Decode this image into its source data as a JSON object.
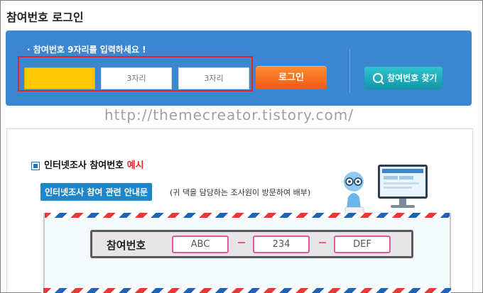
{
  "page": {
    "title": "참여번호 로그인"
  },
  "login": {
    "instruction": "· 참여번호 9자리를 입력하세요 !",
    "fields": [
      {
        "value": "",
        "placeholder": ""
      },
      {
        "value": "",
        "placeholder": "3자리"
      },
      {
        "value": "",
        "placeholder": "3자리"
      }
    ],
    "login_label": "로그인",
    "find_label": "참여번호 찾기"
  },
  "watermark": "http://themecreator.tistory.com/",
  "example": {
    "title": "인터넷조사 참여번호",
    "title_highlight": "예시",
    "guide_button": "인터넷조사 참여 관련 안내문",
    "guide_note": "(귀 댁을 담당하는 조사원이 방문하여 배부)",
    "card_label": "참여번호",
    "parts": [
      "ABC",
      "234",
      "DEF"
    ],
    "separator": "–"
  },
  "colors": {
    "panel": "#3a86d0",
    "highlight_field": "#ffc805",
    "login_button": "#f15a12",
    "find_button": "#1396a7",
    "highlight_box": "#e0262c",
    "example_accent": "#e0262c"
  }
}
